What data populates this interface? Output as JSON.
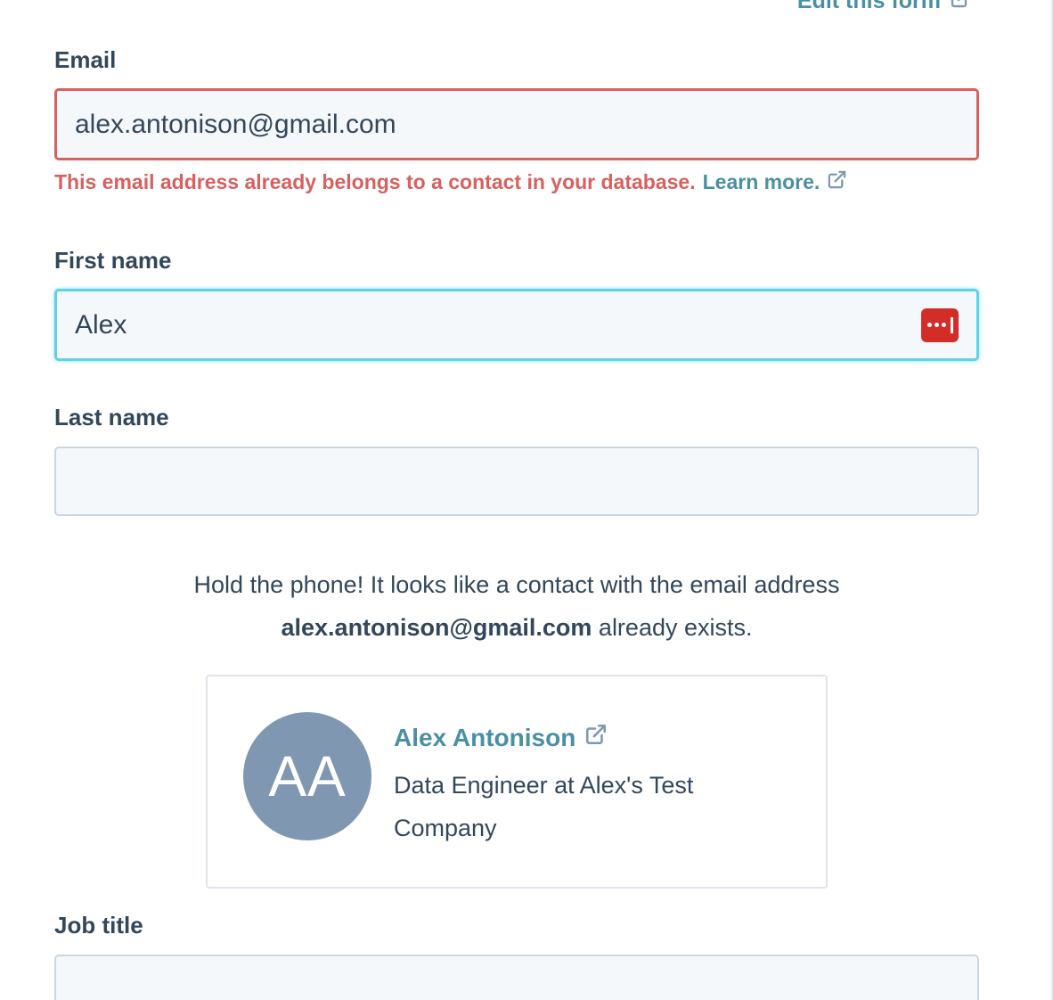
{
  "header": {
    "edit_form_label": "Edit this form"
  },
  "form": {
    "email": {
      "label": "Email",
      "value": "alex.antonison@gmail.com",
      "error": "This email address already belongs to a contact in your database.",
      "learn_more": "Learn more."
    },
    "first_name": {
      "label": "First name",
      "value": "Alex"
    },
    "last_name": {
      "label": "Last name",
      "value": ""
    },
    "job_title": {
      "label": "Job title",
      "value": ""
    }
  },
  "duplicate_notice": {
    "prefix": "Hold the phone! It looks like a contact with the email address",
    "email": "alex.antonison@gmail.com",
    "suffix": "already exists."
  },
  "contact_card": {
    "initials": "AA",
    "name": "Alex Antonison",
    "subtitle": "Data Engineer at Alex's Test Company"
  },
  "colors": {
    "error": "#d9605e",
    "link": "#4a90a4",
    "focus_border": "#5dd3e5",
    "avatar_bg": "#8097b1",
    "password_manager_icon": "#d32d27"
  },
  "icons": {
    "external_link": "external-link-icon",
    "password_manager": "password-manager-icon"
  }
}
